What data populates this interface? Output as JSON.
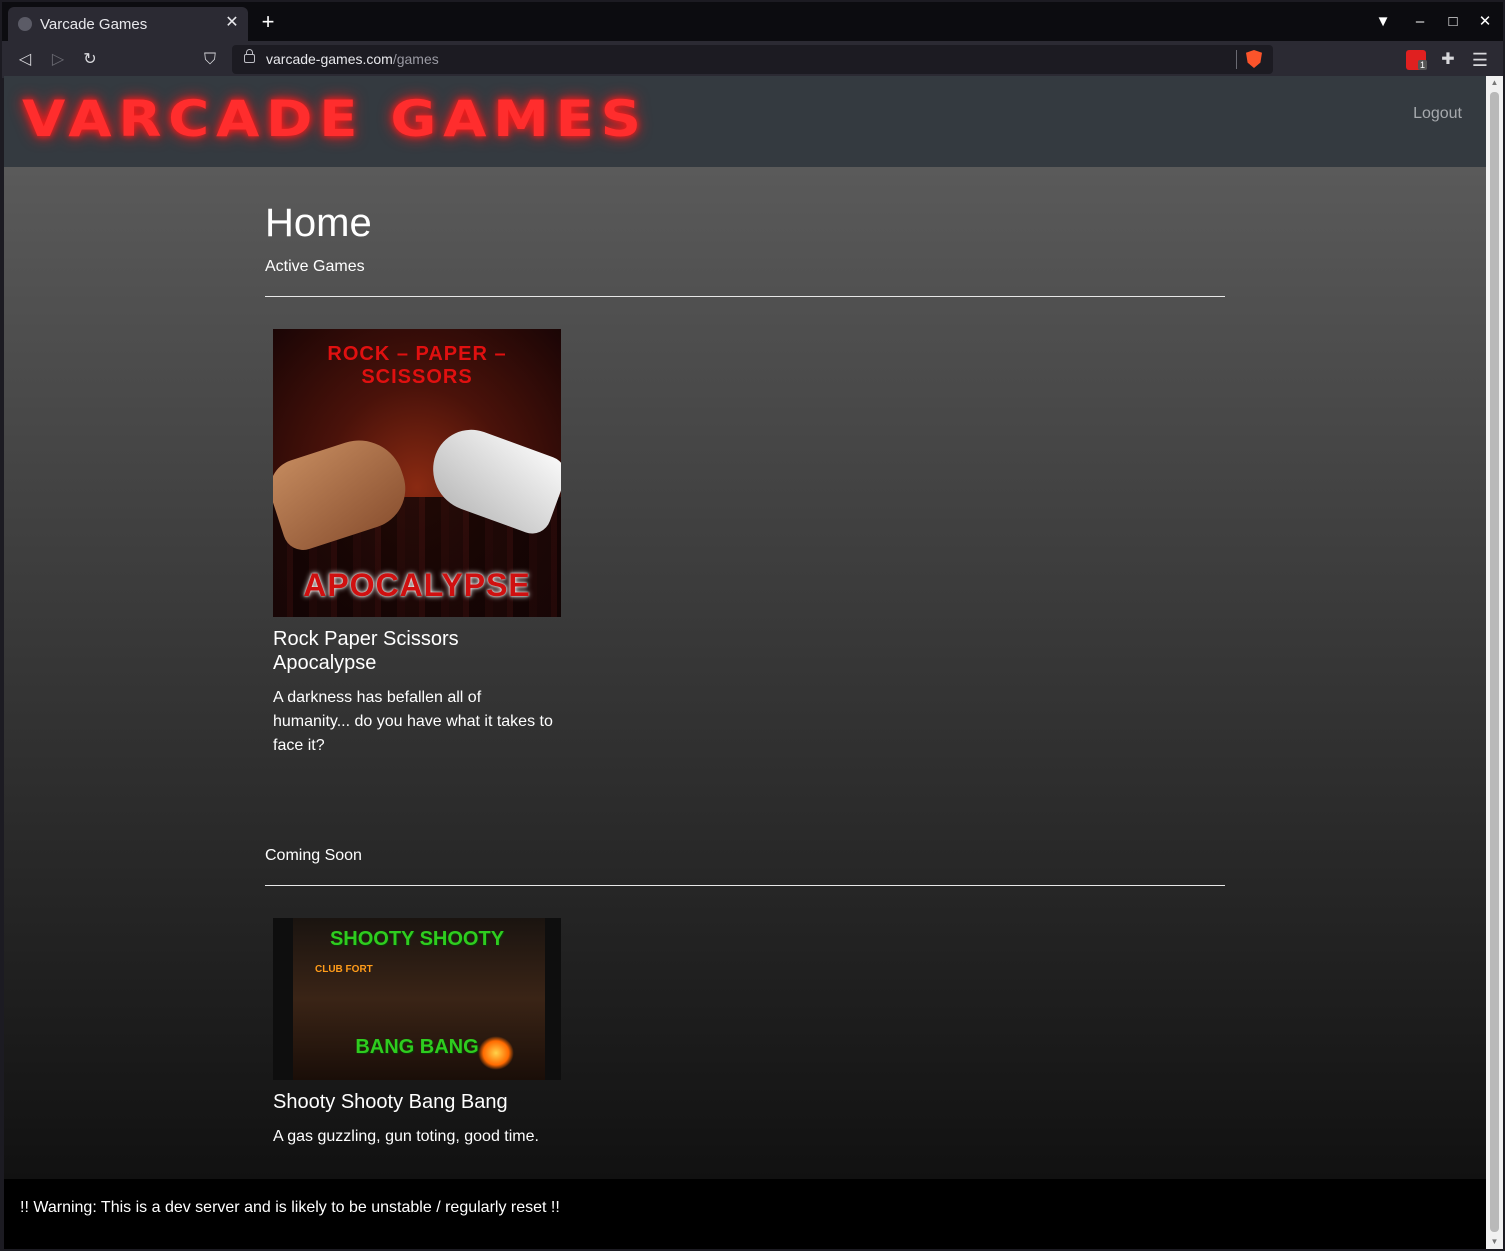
{
  "browser": {
    "tab_title": "Varcade Games",
    "url_domain": "varcade-games.com",
    "url_path": "/games",
    "extension_badge": "1"
  },
  "site": {
    "logo_text": "VARCADE GAMES",
    "logout_label": "Logout",
    "page_title": "Home",
    "colors": {
      "logo": "#ff2d2d",
      "header_bg": "#343a40",
      "footer_bg": "#000000"
    }
  },
  "sections": [
    {
      "title": "Active Games",
      "games": [
        {
          "image_top_text": "ROCK – PAPER – SCISSORS",
          "image_bottom_text": "APOCALYPSE",
          "title": "Rock Paper Scissors Apocalypse",
          "description": "A darkness has befallen all of humanity... do you have what it takes to face it?"
        }
      ]
    },
    {
      "title": "Coming Soon",
      "games": [
        {
          "image_top_text": "SHOOTY SHOOTY",
          "image_bottom_text": "BANG BANG",
          "image_sign_text": "CLUB FORT",
          "title": "Shooty Shooty Bang Bang",
          "description": "A gas guzzling, gun toting, good time."
        }
      ]
    }
  ],
  "footer": {
    "warning": "!! Warning: This is a dev server and is likely to be unstable / regularly reset !!"
  },
  "icons": [
    "globe-icon",
    "close-icon",
    "plus-icon",
    "profile-icon",
    "minimize-icon",
    "maximize-icon",
    "back-icon",
    "forward-icon",
    "reload-icon",
    "bookmark-icon",
    "lock-icon",
    "brave-shield-icon",
    "extension-icon",
    "puzzle-icon",
    "menu-icon"
  ]
}
